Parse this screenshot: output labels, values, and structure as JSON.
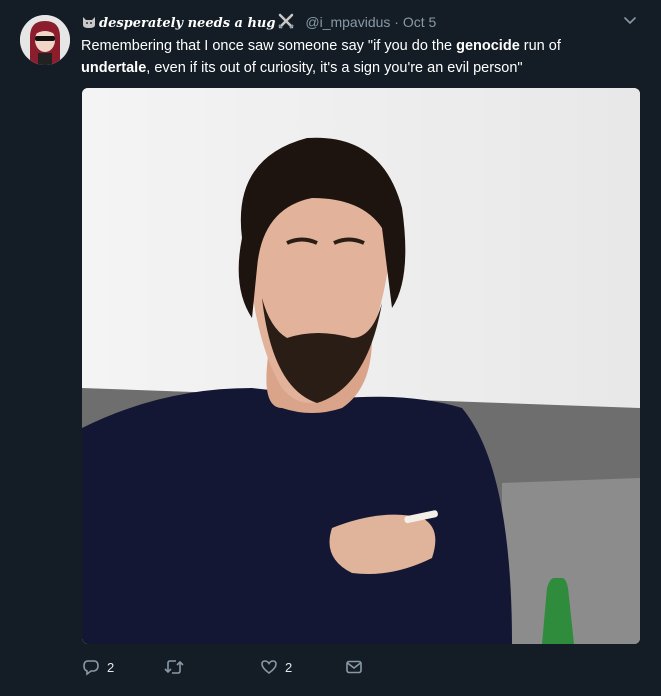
{
  "tweet": {
    "display_name": "desperately needs a hug",
    "handle": "@i_mpavidus",
    "separator": "·",
    "date": "Oct 5",
    "text": {
      "part1": "Remembering that I once saw someone say \"if you do the ",
      "bold1": "genocide",
      "part2": " run of ",
      "bold2": "undertale",
      "part3": ", even if its out of curiosity, it's a sign you're an evil person\""
    },
    "actions": {
      "reply_count": "2",
      "retweet_count": "",
      "like_count": "2"
    }
  },
  "colors": {
    "background": "#141d26",
    "secondary_text": "#8899a6",
    "primary_text": "#ffffff"
  },
  "icons": {
    "name_prefix": "cat-face-icon",
    "name_suffix": "crossed-swords-icon",
    "caret": "chevron-down-icon",
    "reply": "reply-icon",
    "retweet": "retweet-icon",
    "like": "heart-icon",
    "message": "direct-message-icon"
  }
}
